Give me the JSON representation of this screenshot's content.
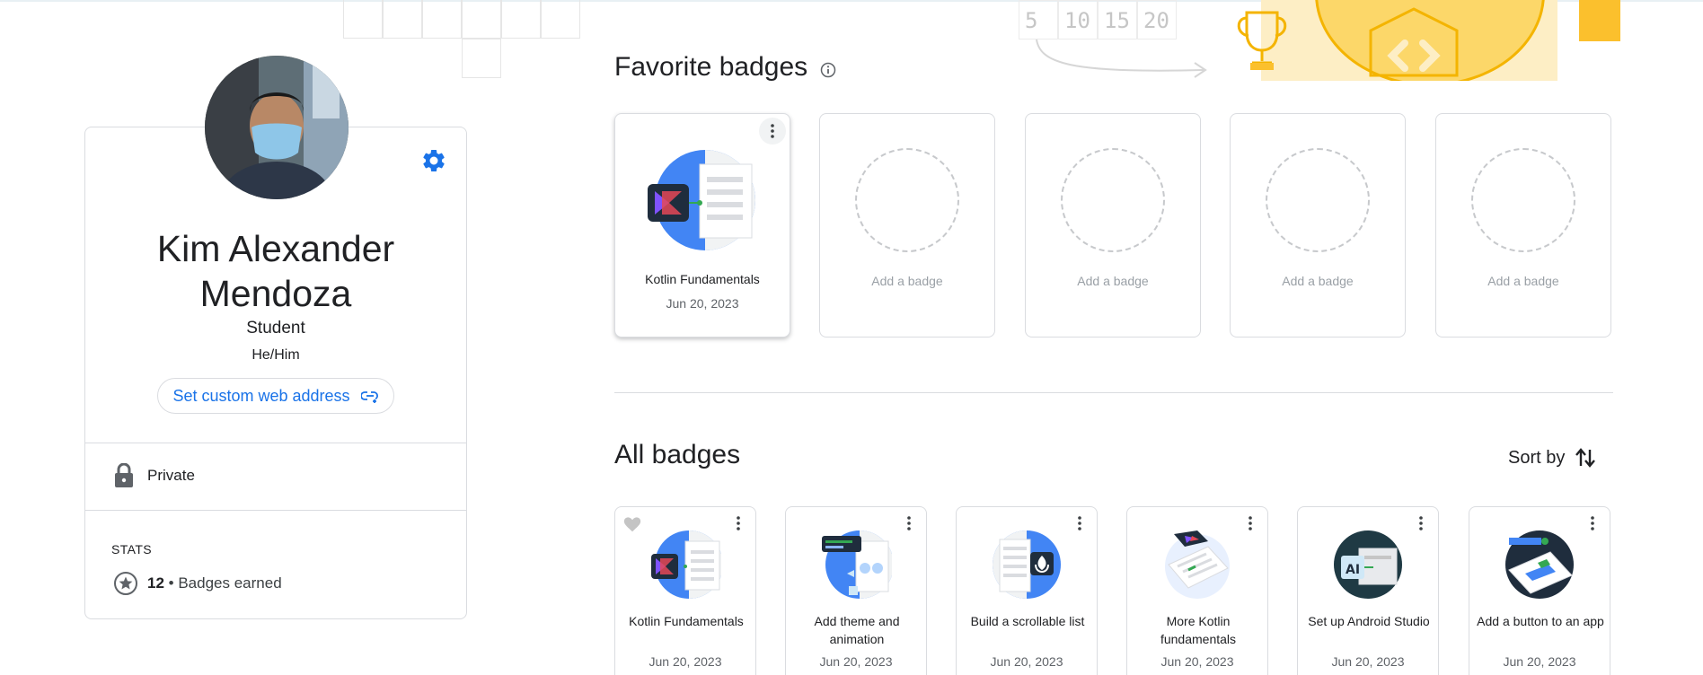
{
  "profile": {
    "name": "Kim Alexander Mendoza",
    "role": "Student",
    "pronouns": "He/Him",
    "custom_address_label": "Set custom web address",
    "privacy": "Private",
    "stats_label": "STATS",
    "badges_count": "12",
    "badges_separator": "•",
    "badges_label": "Badges earned"
  },
  "favorites": {
    "title": "Favorite badges",
    "items": [
      {
        "title": "Kotlin Fundamentals",
        "date": "Jun 20, 2023"
      }
    ],
    "placeholder_label": "Add a badge"
  },
  "all_badges": {
    "title": "All badges",
    "sort_label": "Sort by",
    "items": [
      {
        "title": "Kotlin Fundamentals",
        "date": "Jun 20, 2023"
      },
      {
        "title": "Add theme and animation",
        "date": "Jun 20, 2023"
      },
      {
        "title": "Build a scrollable list",
        "date": "Jun 20, 2023"
      },
      {
        "title": "More Kotlin fundamentals",
        "date": "Jun 20, 2023"
      },
      {
        "title": "Set up Android Studio",
        "date": "Jun 20, 2023"
      },
      {
        "title": "Add a button to an app",
        "date": "Jun 20, 2023"
      }
    ]
  },
  "decoration": {
    "numbers": [
      "5",
      "10",
      "15",
      "20"
    ]
  },
  "icons": {
    "settings": "gear-icon",
    "info": "info-icon",
    "link": "add-link-icon",
    "lock": "lock-icon",
    "star": "star-circle-icon",
    "sort": "sort-arrows-icon",
    "kebab": "more-vert-icon",
    "heart": "heart-icon",
    "trophy": "trophy-icon"
  },
  "colors": {
    "accent": "#1a73e8",
    "badge_blue": "#4285f4",
    "badge_dark": "#1f2d3d",
    "kotlin_purple": "#7f52ff",
    "deco_yellow": "#fbc02d"
  }
}
